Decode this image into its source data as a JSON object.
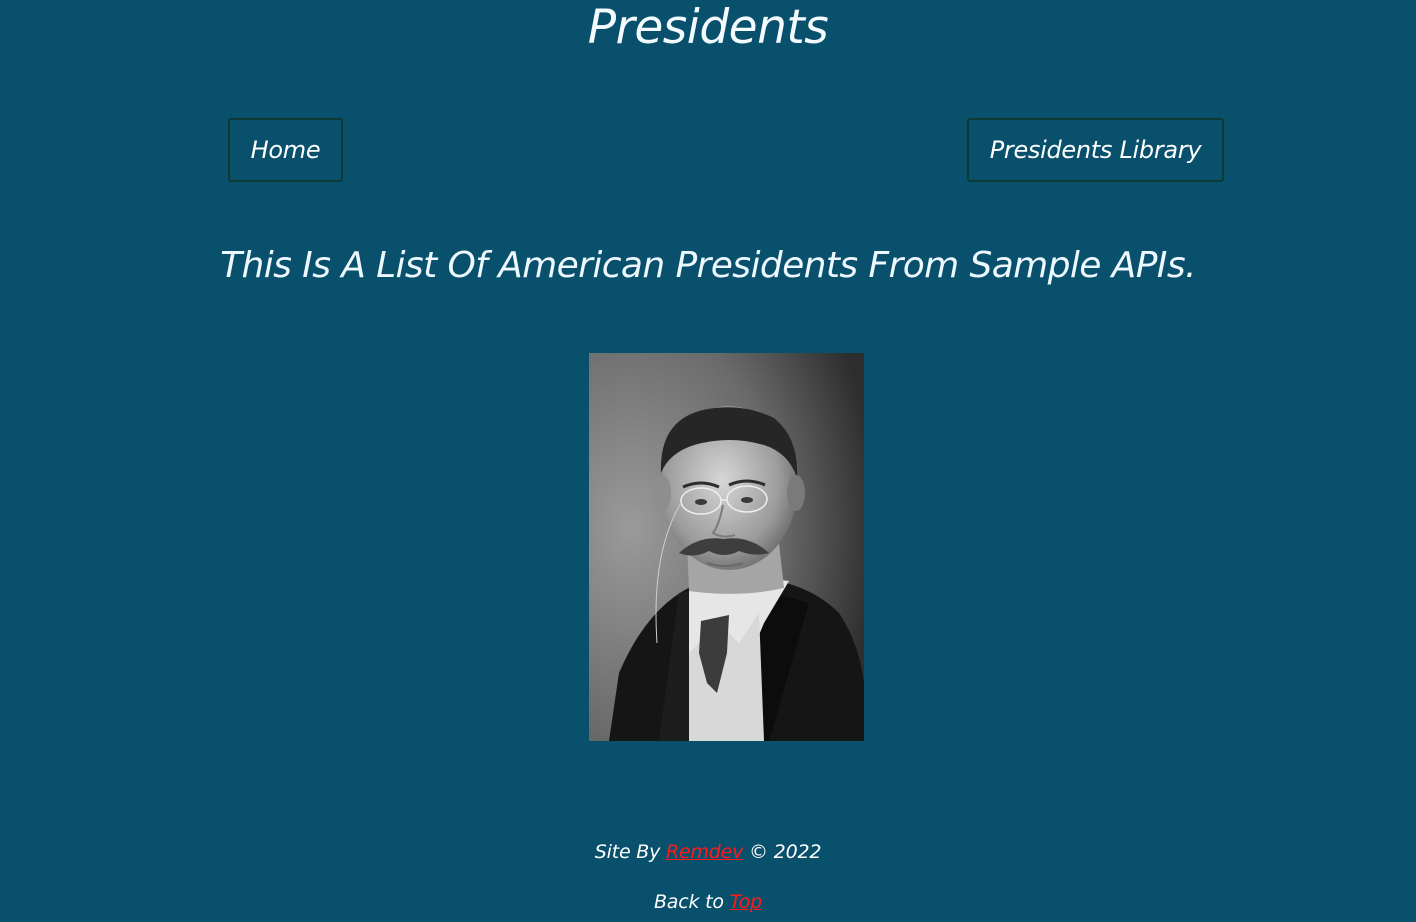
{
  "header": {
    "title": "Presidents"
  },
  "nav": {
    "home_label": "Home",
    "library_label": "Presidents Library"
  },
  "main": {
    "subtitle": "This Is A List Of American Presidents From Sample APIs."
  },
  "footer": {
    "credit_prefix": "Site By ",
    "credit_link": "Remdev",
    "credit_suffix": " © 2022",
    "back_prefix": "Back to ",
    "back_link": "Top"
  },
  "colors": {
    "background": "#09506d",
    "link": "#ff1a1a",
    "button_border": "#0e3a34"
  }
}
